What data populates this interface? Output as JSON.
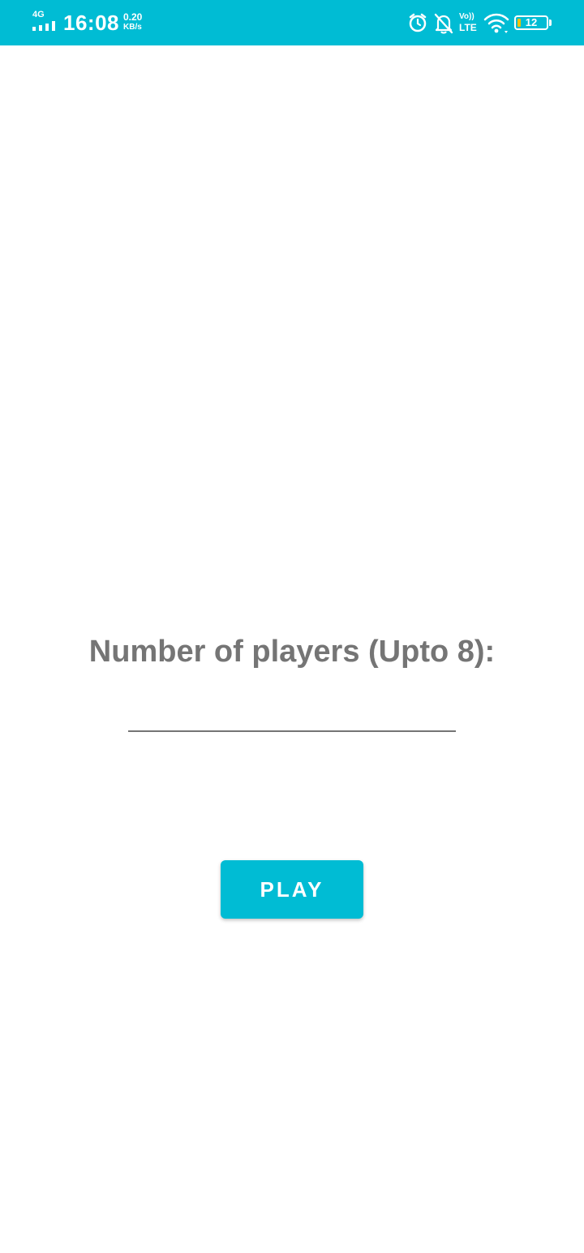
{
  "status_bar": {
    "network_type": "4G",
    "time": "16:08",
    "speed_value": "0.20",
    "speed_unit": "KB/s",
    "volte_top": "Vo))",
    "volte_bottom": "LTE",
    "battery_level": "12",
    "icons": [
      "signal-icon",
      "alarm-icon",
      "bell-off-icon",
      "volte-icon",
      "wifi-icon",
      "battery-icon"
    ],
    "background_color": "#00bcd4"
  },
  "main": {
    "prompt_label": "Number of players (Upto 8):",
    "players_input": {
      "value": "",
      "placeholder": ""
    },
    "play_button_label": "PLAY"
  },
  "colors": {
    "accent": "#00bcd4",
    "label_text": "#757575",
    "battery_low": "#f2c200"
  }
}
